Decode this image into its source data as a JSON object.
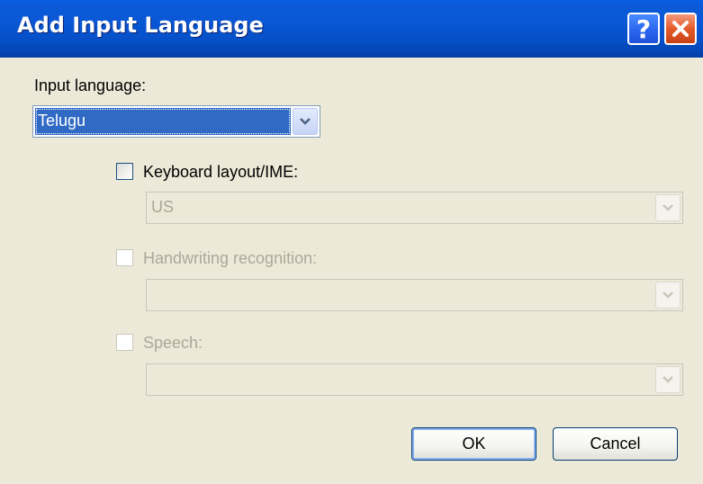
{
  "window": {
    "title": "Add Input Language"
  },
  "titlebar_buttons": {
    "help": "?",
    "close": "×"
  },
  "input_language": {
    "label": "Input language:",
    "value": "Telugu"
  },
  "keyboard_layout": {
    "label": "Keyboard layout/IME:",
    "checked": false,
    "enabled": true,
    "value": "US",
    "combo_enabled": false
  },
  "handwriting": {
    "label": "Handwriting recognition:",
    "checked": false,
    "enabled": false,
    "value": ""
  },
  "speech": {
    "label": "Speech:",
    "checked": false,
    "enabled": false,
    "value": ""
  },
  "buttons": {
    "ok": "OK",
    "cancel": "Cancel"
  },
  "colors": {
    "title_bar": "#0a58d6",
    "dialog_bg": "#ece9d8",
    "selection": "#316ac5",
    "disabled_text": "#aca899"
  }
}
